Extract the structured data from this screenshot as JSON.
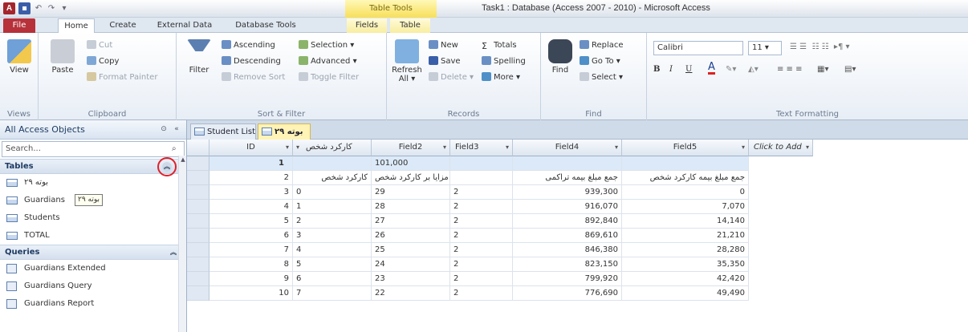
{
  "window": {
    "title": "Task1 : Database (Access 2007 - 2010) - Microsoft Access",
    "contextual_tools": "Table Tools",
    "qat_access": "A"
  },
  "tabs": [
    {
      "label": "File"
    },
    {
      "label": "Home"
    },
    {
      "label": "Create"
    },
    {
      "label": "External Data"
    },
    {
      "label": "Database Tools"
    },
    {
      "label": "Fields"
    },
    {
      "label": "Table"
    }
  ],
  "ribbon": {
    "views": {
      "view": "View",
      "label": "Views"
    },
    "clipboard": {
      "paste": "Paste",
      "cut": "Cut",
      "copy": "Copy",
      "format_painter": "Format Painter",
      "label": "Clipboard"
    },
    "sort_filter": {
      "filter": "Filter",
      "ascending": "Ascending",
      "descending": "Descending",
      "remove_sort": "Remove Sort",
      "selection": "Selection",
      "advanced": "Advanced",
      "toggle_filter": "Toggle Filter",
      "label": "Sort & Filter"
    },
    "records": {
      "refresh": "Refresh",
      "refresh_all": "All",
      "new": "New",
      "save": "Save",
      "delete": "Delete",
      "totals": "Totals",
      "spelling": "Spelling",
      "more": "More",
      "label": "Records"
    },
    "find": {
      "find": "Find",
      "replace": "Replace",
      "goto": "Go To",
      "select": "Select",
      "label": "Find"
    },
    "text_formatting": {
      "font": "Calibri",
      "size": "11",
      "bold": "B",
      "italic": "I",
      "underline": "U",
      "font_color_glyph": "A",
      "label": "Text Formatting"
    }
  },
  "nav": {
    "header": "All Access Objects",
    "search_placeholder": "Search...",
    "sections": {
      "tables": "Tables",
      "queries": "Queries"
    },
    "tables": [
      "۲۹ بوته",
      "Guardians",
      "Students",
      "TOTAL"
    ],
    "tooltip": "۲۹ بوته",
    "queries": [
      "Guardians Extended",
      "Guardians Query",
      "Guardians Report"
    ]
  },
  "doctabs": [
    {
      "label": "Student List",
      "active": false
    },
    {
      "label": "۲۹ بوته",
      "active": true
    }
  ],
  "sheet": {
    "headers": [
      "ID",
      "کارکرد شخص",
      "Field2",
      "Field3",
      "Field4",
      "Field5",
      "Click to Add"
    ],
    "rows": [
      {
        "id": "1",
        "c1": "",
        "c2": "101,000",
        "c3": "",
        "c4": "",
        "c5": ""
      },
      {
        "id": "2",
        "c1": "کارکرد شخص",
        "c2": "مزایا بر کارکرد شخص",
        "c3": "",
        "c4": "جمع مبلغ بیمه تراکمی",
        "c5": "جمع مبلغ بیمه کارکرد شخص"
      },
      {
        "id": "3",
        "c1": "0",
        "c2": "29",
        "c3": "2",
        "c4": "939,300",
        "c5": "0"
      },
      {
        "id": "4",
        "c1": "1",
        "c2": "28",
        "c3": "2",
        "c4": "916,070",
        "c5": "7,070"
      },
      {
        "id": "5",
        "c1": "2",
        "c2": "27",
        "c3": "2",
        "c4": "892,840",
        "c5": "14,140"
      },
      {
        "id": "6",
        "c1": "3",
        "c2": "26",
        "c3": "2",
        "c4": "869,610",
        "c5": "21,210"
      },
      {
        "id": "7",
        "c1": "4",
        "c2": "25",
        "c3": "2",
        "c4": "846,380",
        "c5": "28,280"
      },
      {
        "id": "8",
        "c1": "5",
        "c2": "24",
        "c3": "2",
        "c4": "823,150",
        "c5": "35,350"
      },
      {
        "id": "9",
        "c1": "6",
        "c2": "23",
        "c3": "2",
        "c4": "799,920",
        "c5": "42,420"
      },
      {
        "id": "10",
        "c1": "7",
        "c2": "22",
        "c3": "2",
        "c4": "776,690",
        "c5": "49,490"
      }
    ]
  }
}
